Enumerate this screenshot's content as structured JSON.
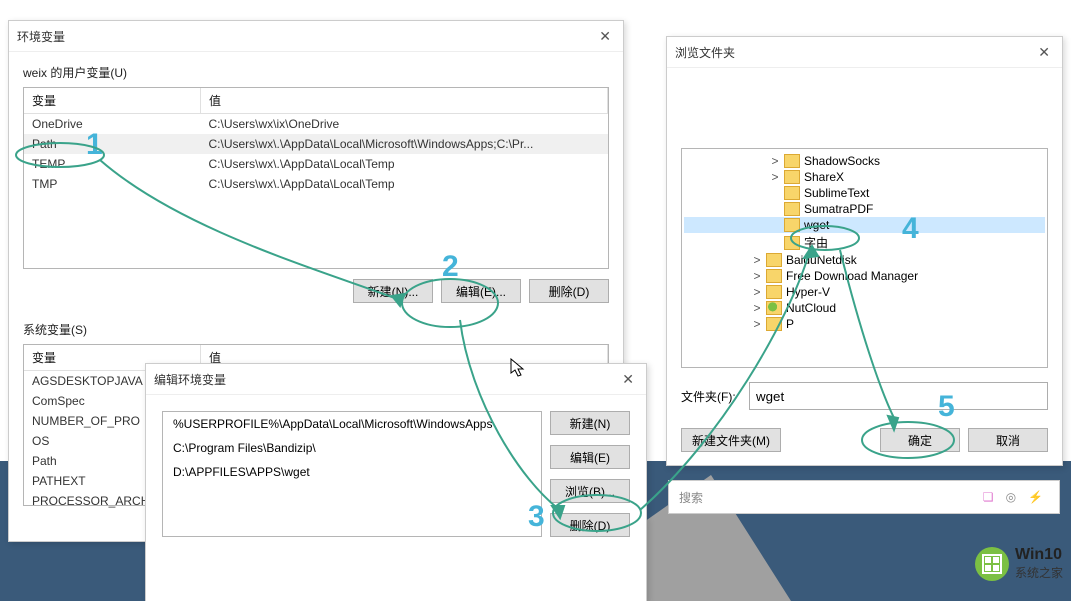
{
  "env": {
    "title": "环境变量",
    "user_label": "weix 的用户变量(U)",
    "sys_label": "系统变量(S)",
    "col_var": "变量",
    "col_val": "值",
    "user_rows": [
      {
        "var": "OneDrive",
        "val": "C:\\Users\\wx\\ix\\OneDrive"
      },
      {
        "var": "Path",
        "val": "C:\\Users\\wx\\.\\AppData\\Local\\Microsoft\\WindowsApps;C:\\Pr..."
      },
      {
        "var": "TEMP",
        "val": "C:\\Users\\wx\\.\\AppData\\Local\\Temp"
      },
      {
        "var": "TMP",
        "val": "C:\\Users\\wx\\.\\AppData\\Local\\Temp"
      }
    ],
    "sys_rows": [
      {
        "var": "AGSDESKTOPJAVA"
      },
      {
        "var": "ComSpec"
      },
      {
        "var": "NUMBER_OF_PRO"
      },
      {
        "var": "OS"
      },
      {
        "var": "Path"
      },
      {
        "var": "PATHEXT"
      },
      {
        "var": "PROCESSOR_ARCH"
      }
    ],
    "btn_new": "新建(N)...",
    "btn_edit": "编辑(E)...",
    "btn_del": "删除(D)"
  },
  "edit": {
    "title": "编辑环境变量",
    "lines": [
      "%USERPROFILE%\\AppData\\Local\\Microsoft\\WindowsApps",
      "C:\\Program Files\\Bandizip\\",
      "D:\\APPFILES\\APPS\\wget"
    ],
    "btn_new": "新建(N)",
    "btn_edit": "编辑(E)",
    "btn_browse": "浏览(B)...",
    "btn_del": "删除(D)"
  },
  "browse": {
    "title": "浏览文件夹",
    "items": [
      {
        "indent": 2,
        "exp": ">",
        "name": "ShadowSocks"
      },
      {
        "indent": 2,
        "exp": ">",
        "name": "ShareX"
      },
      {
        "indent": 2,
        "exp": "",
        "name": "SublimeText"
      },
      {
        "indent": 2,
        "exp": "",
        "name": "SumatraPDF"
      },
      {
        "indent": 2,
        "exp": "",
        "name": "wget",
        "sel": true
      },
      {
        "indent": 2,
        "exp": "",
        "name": "字由"
      },
      {
        "indent": 1,
        "exp": ">",
        "name": "BaiduNetdisk"
      },
      {
        "indent": 1,
        "exp": ">",
        "name": "Free Download Manager"
      },
      {
        "indent": 1,
        "exp": ">",
        "name": "Hyper-V"
      },
      {
        "indent": 1,
        "exp": ">",
        "name": "NutCloud",
        "special": true
      },
      {
        "indent": 1,
        "exp": ">",
        "name": "P"
      }
    ],
    "folder_label": "文件夹(F):",
    "folder_value": "wget",
    "btn_newfolder": "新建文件夹(M)",
    "btn_ok": "确定",
    "btn_cancel": "取消"
  },
  "search": {
    "placeholder": "搜索"
  },
  "brand": {
    "l1": "Win10",
    "l2": "系统之家"
  },
  "ann": {
    "n1": "1",
    "n2": "2",
    "n3": "3",
    "n4": "4",
    "n5": "5"
  }
}
